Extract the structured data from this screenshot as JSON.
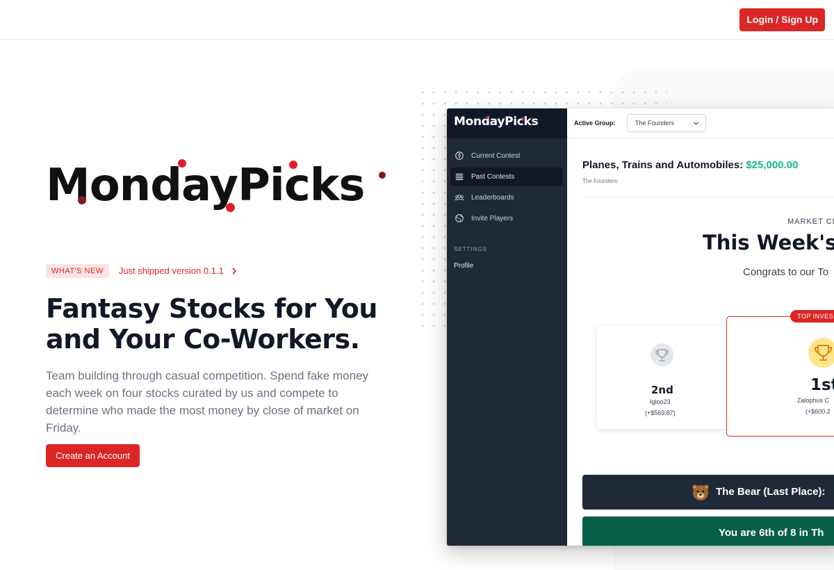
{
  "nav": {
    "login_label": "Login / Sign Up"
  },
  "hero": {
    "logo_text": "MondayPicks",
    "whats_new_badge": "WHAT'S NEW",
    "whats_new_text": "Just shipped version 0.1.1",
    "headline_line1": "Fantasy Stocks for You",
    "headline_line2": "and Your Co-Workers.",
    "subtext": "Team building through casual competition. Spend fake money each week on four stocks curated by us and compete to determine who made the most money by close of market on Friday.",
    "cta_label": "Create an Account"
  },
  "app_preview": {
    "logo_text": "MondayPicks",
    "sidebar": {
      "items": [
        {
          "label": "Current Contest",
          "icon": "fire-icon",
          "active": false
        },
        {
          "label": "Past Contests",
          "icon": "list-icon",
          "active": true
        },
        {
          "label": "Leaderboards",
          "icon": "users-icon",
          "active": false
        },
        {
          "label": "Invite Players",
          "icon": "globe-icon",
          "active": false
        }
      ],
      "settings_label": "SETTINGS",
      "profile_label": "Profile"
    },
    "header": {
      "active_group_label": "Active Group:",
      "group_value": "The Founders"
    },
    "contest": {
      "title": "Planes, Trains and Automobiles:",
      "amount": "$25,000.00",
      "group": "The Founders:"
    },
    "results": {
      "market_label": "MARKET CL",
      "week_title": "This Week's",
      "congrats": "Congrats to our To",
      "top_badge": "TOP INVES",
      "second": {
        "place": "2nd",
        "name": "Igloo23",
        "gain": "(+$569.87)"
      },
      "first": {
        "place": "1st",
        "name": "Zalophus C",
        "gain": "(+$600.2"
      }
    },
    "bear_text": "The Bear (Last Place):",
    "rank_text": "You are 6th of 8 in Th"
  },
  "colors": {
    "brand_red": "#dc2626",
    "sidebar_bg": "#1f2937",
    "money_green": "#10b981",
    "rank_green": "#065f46"
  }
}
